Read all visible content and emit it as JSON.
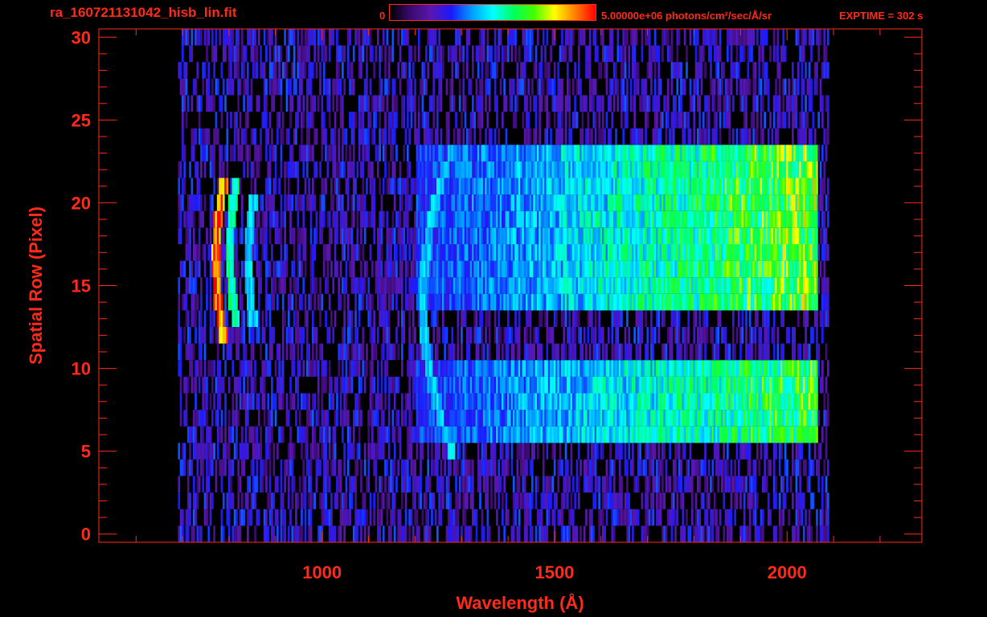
{
  "header": {
    "title": "ra_160721131042_hisb_lin.fit",
    "colorbar_min": "0",
    "colorbar_max": "5.00000e+06 photons/cm²/sec/Å/sr",
    "exptime": "EXPTIME = 302 s"
  },
  "colors": {
    "axis": "#ff2a1a",
    "background": "#000000",
    "colormap": [
      "#000000",
      "#3a0a6e",
      "#5a17b0",
      "#1a1aff",
      "#00a0ff",
      "#00ffff",
      "#00ff60",
      "#40ff00",
      "#ffff00",
      "#ff8000",
      "#ff0000"
    ]
  },
  "chart_data": {
    "type": "heatmap",
    "title": "ra_160721131042_hisb_lin.fit",
    "xlabel": "Wavelength (Å)",
    "ylabel": "Spatial Row (Pixel)",
    "xlim": [
      520,
      2290
    ],
    "ylim": [
      -0.5,
      30.5
    ],
    "xticks": [
      1000,
      1500,
      2000
    ],
    "yticks": [
      0,
      5,
      10,
      15,
      20,
      25,
      30
    ],
    "colorbar_range": [
      0,
      5000000
    ],
    "colorbar_units": "photons/cm²/sec/Å/sr",
    "data_extent": {
      "wavelength": [
        690,
        2090
      ],
      "rows": [
        0,
        30
      ]
    },
    "features": [
      {
        "name": "bright arc",
        "wavelength": 770,
        "rows": [
          12,
          21
        ],
        "level": 0.9
      },
      {
        "name": "arc",
        "wavelength": 800,
        "rows": [
          13,
          21
        ],
        "level": 0.55
      },
      {
        "name": "arc",
        "wavelength": 840,
        "rows": [
          13,
          20
        ],
        "level": 0.45
      },
      {
        "name": "emission line",
        "wavelength": 1215,
        "rows": [
          5,
          23
        ],
        "level": 0.45
      }
    ],
    "bands": [
      {
        "rows": [
          14,
          23
        ],
        "wavelength": [
          1200,
          2065
        ],
        "level_start": 0.3,
        "level_end": 0.7
      },
      {
        "rows": [
          6,
          10
        ],
        "wavelength": [
          1200,
          2065
        ],
        "level_start": 0.3,
        "level_end": 0.65
      }
    ]
  }
}
